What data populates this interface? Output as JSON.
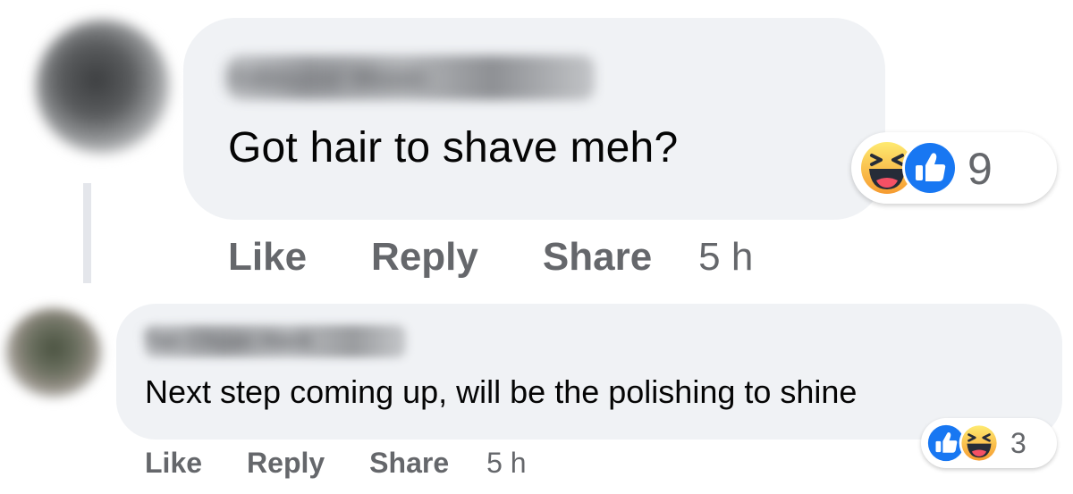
{
  "comments": [
    {
      "author": "Edmund Moon",
      "text": "Got hair to shave meh?",
      "reaction_count": "9",
      "reaction_icons": [
        "haha-icon",
        "like-icon"
      ],
      "actions": {
        "like": "Like",
        "reply": "Reply",
        "share": "Share"
      },
      "timestamp": "5 h"
    },
    {
      "author": "Tan Chuan Hock",
      "text": "Next step coming up, will be the polishing to shine",
      "reaction_count": "3",
      "reaction_icons": [
        "like-icon",
        "haha-icon"
      ],
      "actions": {
        "like": "Like",
        "reply": "Reply",
        "share": "Share"
      },
      "timestamp": "5 h"
    }
  ],
  "colors": {
    "bubble": "#f0f2f5",
    "text": "#050505",
    "secondary_text": "#65676b",
    "like_blue": "#1877f2",
    "haha_yellow": "#f7b125"
  }
}
